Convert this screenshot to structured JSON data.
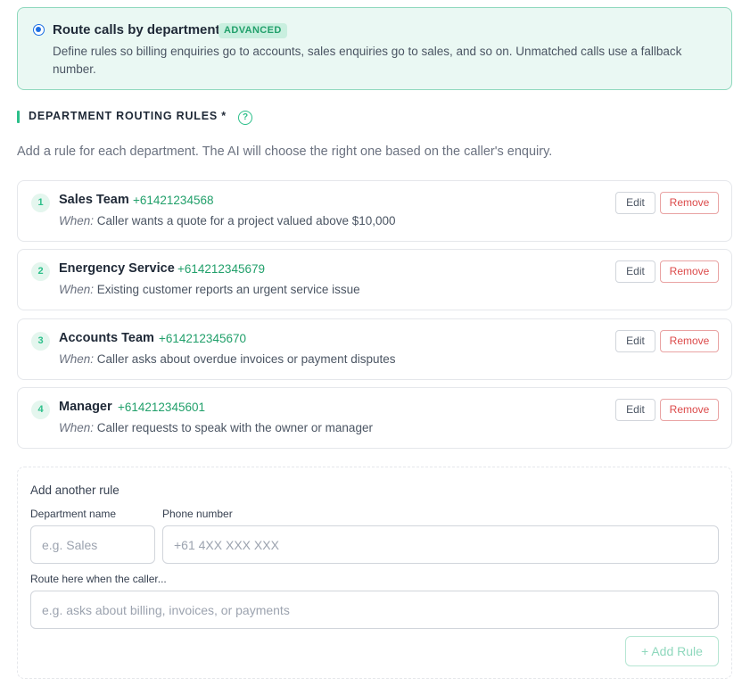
{
  "mode": {
    "title": "Route calls by department",
    "badge": "ADVANCED",
    "description": "Define rules so billing enquiries go to accounts, sales enquiries go to sales, and so on. Unmatched calls use a fallback number."
  },
  "section": {
    "title": "DEPARTMENT ROUTING RULES *",
    "help_icon": "?",
    "description": "Add a rule for each department. The AI will choose the right one based on the caller's enquiry."
  },
  "rules": [
    {
      "num": "1",
      "name": "Sales Team",
      "phone": "+61421234568",
      "when_label": "When:",
      "when": "Caller wants a quote for a project valued above $10,000"
    },
    {
      "num": "2",
      "name": "Energency Service",
      "phone": "+614212345679",
      "when_label": "When:",
      "when": "Existing customer reports an urgent service issue"
    },
    {
      "num": "3",
      "name": "Accounts Team",
      "phone": "+614212345670",
      "when_label": "When:",
      "when": "Caller asks about overdue invoices or payment disputes"
    },
    {
      "num": "4",
      "name": "Manager",
      "phone": "+614212345601",
      "when_label": "When:",
      "when": "Caller requests to speak with the owner or manager"
    }
  ],
  "rule_actions": {
    "edit_label": "Edit",
    "remove_label": "Remove"
  },
  "add_rule": {
    "title": "Add another rule",
    "department_label": "Department name",
    "department_placeholder": "e.g. Sales",
    "department_value": "",
    "phone_label": "Phone number",
    "phone_placeholder": "+61 4XX XXX XXX",
    "phone_value": "",
    "condition_label": "Route here when the caller...",
    "condition_placeholder": "e.g. asks about billing, invoices, or payments",
    "condition_value": "",
    "button_label": "+ Add Rule"
  },
  "colors": {
    "accent": "#2cbf8a",
    "accent_text": "#22a06b",
    "remove": "#dc4a4a",
    "radio": "#1d6fe3"
  }
}
